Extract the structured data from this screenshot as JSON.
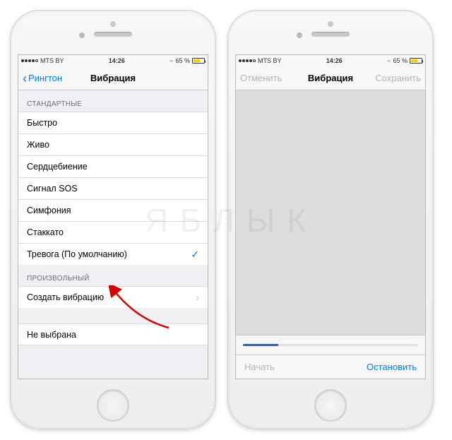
{
  "status": {
    "carrier": "MTS BY",
    "time": "14:26",
    "battery_pct": "65 %"
  },
  "left_screen": {
    "nav_back": "Рингтон",
    "nav_title": "Вибрация",
    "group_standard": "СТАНДАРТНЫЕ",
    "items_standard": [
      "Быстро",
      "Живо",
      "Сердцебиение",
      "Сигнал SOS",
      "Симфония",
      "Стаккато",
      "Тревога (По умолчанию)"
    ],
    "selected_index": 6,
    "group_custom": "ПРОИЗВОЛЬНЫЙ",
    "create_label": "Создать вибрацию",
    "none_label": "Не выбрана"
  },
  "right_screen": {
    "nav_cancel": "Отменить",
    "nav_title": "Вибрация",
    "nav_save": "Сохранить",
    "toolbar_start": "Начать",
    "toolbar_stop": "Остановить",
    "progress_pct": 20
  },
  "watermark": "ЯБЛЫК"
}
